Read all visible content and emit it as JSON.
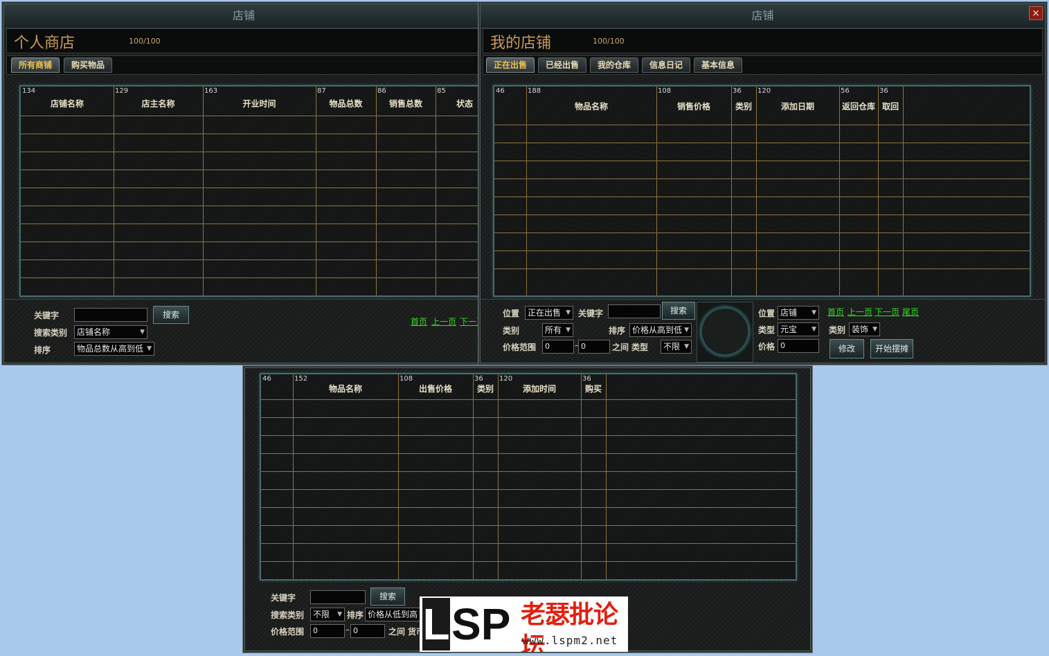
{
  "colors": {
    "background": "#a9c9ec",
    "grid_line": "#8f7442",
    "link": "#33dd22",
    "shop_name": "#c89a58",
    "active_tab": "#f0c050"
  },
  "shop_list": {
    "title": "店铺",
    "shop_name": "个人商店",
    "capacity": "100/100",
    "tabs": [
      {
        "label": "所有商铺",
        "active": true
      },
      {
        "label": "购买物品",
        "active": false
      }
    ],
    "columns": [
      {
        "width": "134",
        "label": "店铺名称"
      },
      {
        "width": "129",
        "label": "店主名称"
      },
      {
        "width": "163",
        "label": "开业时间"
      },
      {
        "width": "87",
        "label": "物品总数"
      },
      {
        "width": "86",
        "label": "销售总数"
      },
      {
        "width": "85",
        "label": "状态"
      }
    ],
    "keyword_label": "关键字",
    "keyword_value": "",
    "search_button": "搜索",
    "search_type_label": "搜索类别",
    "search_type_value": "店铺名称",
    "sort_label": "排序",
    "sort_value": "物品总数从高到低",
    "pagination": {
      "first": "首页",
      "prev": "上一页",
      "next": "下一页"
    }
  },
  "my_shop": {
    "title": "店铺",
    "close_icon": "close-icon",
    "shop_name": "我的店铺",
    "capacity": "100/100",
    "tabs": [
      {
        "label": "正在出售",
        "active": true
      },
      {
        "label": "已经出售",
        "active": false
      },
      {
        "label": "我的仓库",
        "active": false
      },
      {
        "label": "信息日记",
        "active": false
      },
      {
        "label": "基本信息",
        "active": false
      }
    ],
    "columns": [
      {
        "width": "46",
        "label": ""
      },
      {
        "width": "188",
        "label": "物品名称"
      },
      {
        "width": "108",
        "label": "销售价格"
      },
      {
        "width": "36",
        "label": "类别"
      },
      {
        "width": "120",
        "label": "添加日期"
      },
      {
        "width": "56",
        "label": "返回仓库"
      },
      {
        "width": "36",
        "label": "取回"
      }
    ],
    "location_label": "位置",
    "location_value": "正在出售",
    "keyword_label": "关键字",
    "keyword_value": "",
    "search_button": "搜索",
    "category_label": "类别",
    "category_value": "所有",
    "sort_label": "排序",
    "sort_value": "价格从高到低",
    "price_range_label": "价格范围",
    "price_min": "0",
    "price_max": "0",
    "between_label": "之间",
    "type_label": "类型",
    "type_value": "不限",
    "right_location_label": "位置",
    "right_location_value": "店铺",
    "right_type_label": "类型",
    "right_type_value": "元宝",
    "right_category_label": "类别",
    "right_category_value": "装饰",
    "right_price_label": "价格",
    "right_price_value": "0",
    "pagination": {
      "first": "首页",
      "prev": "上一页",
      "next": "下一页",
      "last": "尾页"
    },
    "modify_button": "修改",
    "start_button": "开始摆摊"
  },
  "buy_panel": {
    "columns": [
      {
        "width": "46",
        "label": ""
      },
      {
        "width": "152",
        "label": "物品名称"
      },
      {
        "width": "108",
        "label": "出售价格"
      },
      {
        "width": "36",
        "label": "类别"
      },
      {
        "width": "120",
        "label": "添加时间"
      },
      {
        "width": "36",
        "label": "购买"
      }
    ],
    "keyword_label": "关键字",
    "keyword_value": "",
    "search_button": "搜索",
    "search_type_label": "搜索类别",
    "search_type_value": "不限",
    "sort_label": "排序",
    "sort_value": "价格从低到高",
    "price_range_label": "价格范围",
    "price_min": "0",
    "price_max": "0",
    "between_label": "之间",
    "currency_label": "货币"
  },
  "watermark": {
    "logo_letters": [
      "L",
      "SP"
    ],
    "site_name": "老瑟批论坛",
    "url": "www.lspm2.net"
  }
}
